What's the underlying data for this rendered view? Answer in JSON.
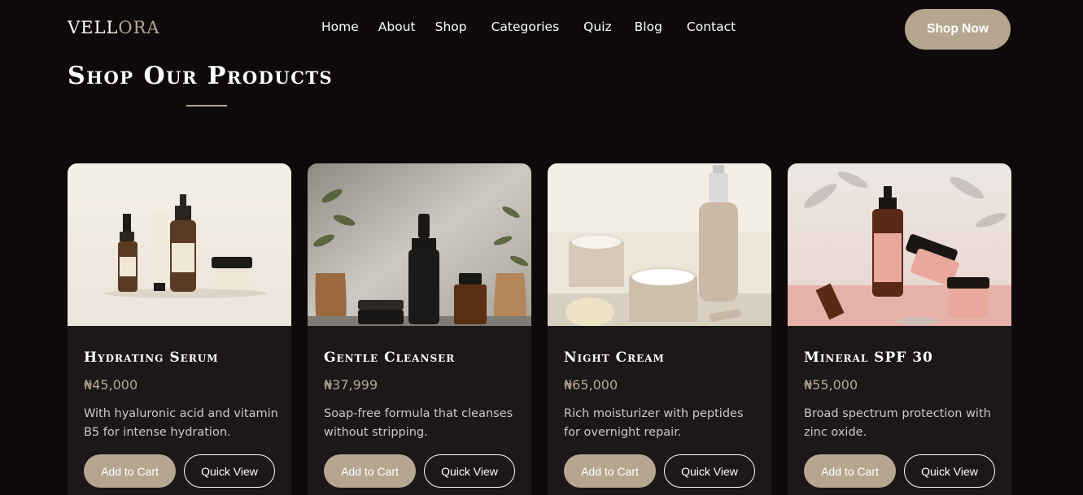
{
  "nav": {
    "logo_primary": "VELL",
    "logo_accent": "ORA",
    "links": [
      "Home",
      "About",
      "Shop",
      "Categories",
      "Quiz",
      "Blog",
      "Contact"
    ],
    "cta_label": "Shop Now"
  },
  "section": {
    "title": "Shop Our Products"
  },
  "colors": {
    "background": "#0e0a0c",
    "card": "#1c1719",
    "accent": "#b6a690"
  },
  "products": [
    {
      "name": "Hydrating Serum",
      "price": "₦45,000",
      "description": "With hyaluronic acid and vitamin B5 for intense hydration.",
      "add_to_cart": "Add to Cart",
      "quick_view": "Quick View",
      "image_alt": "serum-bottles-image"
    },
    {
      "name": "Gentle Cleanser",
      "price": "₦37,999",
      "description": "Soap-free formula that cleanses without stripping.",
      "add_to_cart": "Add to Cart",
      "quick_view": "Quick View",
      "image_alt": "cleanser-bottles-image"
    },
    {
      "name": "Night Cream",
      "price": "₦65,000",
      "description": "Rich moisturizer with peptides for overnight repair.",
      "add_to_cart": "Add to Cart",
      "quick_view": "Quick View",
      "image_alt": "cream-jars-image"
    },
    {
      "name": "Mineral SPF 30",
      "price": "₦55,000",
      "description": "Broad spectrum protection with zinc oxide.",
      "add_to_cart": "Add to Cart",
      "quick_view": "Quick View",
      "image_alt": "spf-bottles-image"
    }
  ]
}
